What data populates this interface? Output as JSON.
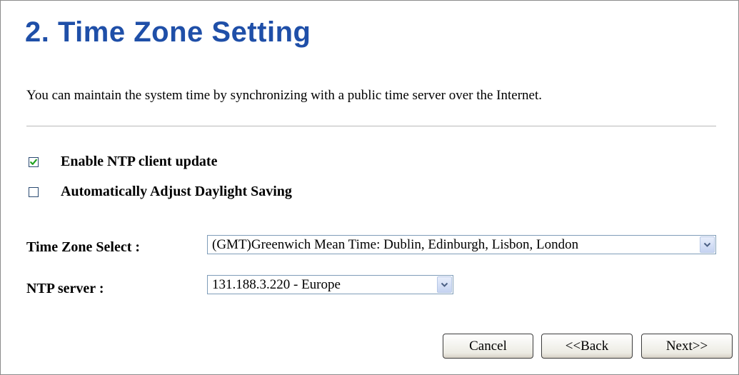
{
  "page": {
    "title": "2. Time Zone Setting",
    "description": "You can maintain the system time by synchronizing with a public time server over the Internet."
  },
  "options": {
    "ntp_client": {
      "label": "Enable NTP client update",
      "checked": true
    },
    "daylight_saving": {
      "label": "Automatically Adjust Daylight Saving",
      "checked": false
    }
  },
  "fields": {
    "time_zone": {
      "label": "Time Zone Select :",
      "value": "(GMT)Greenwich Mean Time: Dublin, Edinburgh, Lisbon, London"
    },
    "ntp_server": {
      "label": "NTP server :",
      "value": "131.188.3.220 - Europe"
    }
  },
  "buttons": {
    "cancel": "Cancel",
    "back": "<<Back",
    "next": "Next>>"
  },
  "colors": {
    "title": "#1f4fa8",
    "checkmark": "#21a121"
  },
  "icons": {
    "checkbox_checked": "check-icon",
    "dropdown": "chevron-down-icon"
  }
}
